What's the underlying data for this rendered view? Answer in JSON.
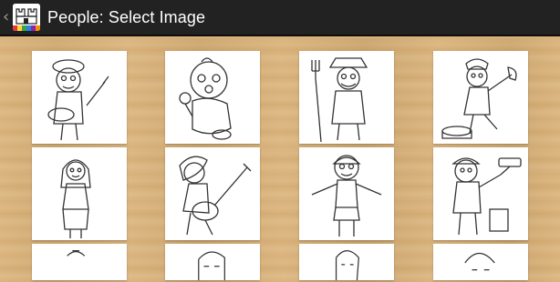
{
  "action_bar": {
    "up_icon": "chevron-left-icon",
    "app_icon": "castle-drawing-icon",
    "title": "People: Select Image"
  },
  "grid": {
    "items": [
      {
        "subject": "painter-with-brush-and-palette"
      },
      {
        "subject": "baby-with-rattle"
      },
      {
        "subject": "farmer-with-pitchfork"
      },
      {
        "subject": "lumberjack-with-axe"
      },
      {
        "subject": "girl-with-long-hair"
      },
      {
        "subject": "rock-guitarist"
      },
      {
        "subject": "swimmer-boy-with-cap"
      },
      {
        "subject": "house-painter-with-roller"
      },
      {
        "subject": "person-partial-1"
      },
      {
        "subject": "person-partial-2"
      },
      {
        "subject": "person-partial-3"
      },
      {
        "subject": "person-partial-4"
      }
    ]
  },
  "colors": {
    "action_bar_bg": "#222222",
    "title_text": "#ffffff",
    "background_wood": "#d9b27a",
    "card_bg": "#ffffff"
  }
}
